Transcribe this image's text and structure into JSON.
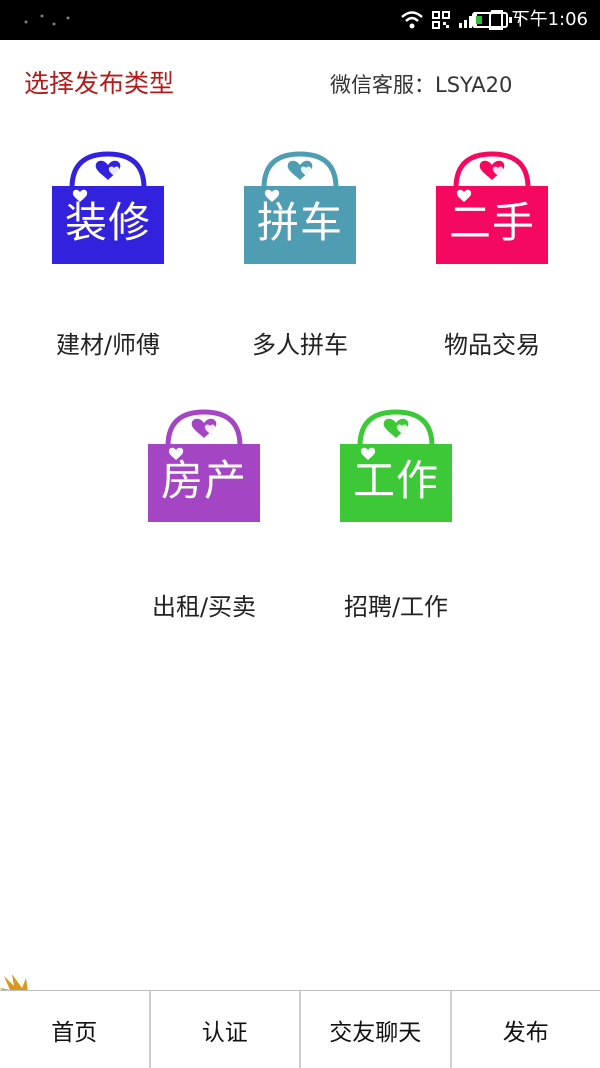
{
  "statusbar": {
    "time": "下午1:06"
  },
  "header": {
    "title": "选择发布类型",
    "service": "微信客服：LSYA20"
  },
  "categories": [
    {
      "icon_text": "装修",
      "label": "建材/师傅",
      "color": "#3322dd"
    },
    {
      "icon_text": "拼车",
      "label": "多人拼车",
      "color": "#4f9db2"
    },
    {
      "icon_text": "二手",
      "label": "物品交易",
      "color": "#f5085f"
    },
    {
      "icon_text": "房产",
      "label": "出租/买卖",
      "color": "#a445c4"
    },
    {
      "icon_text": "工作",
      "label": "招聘/工作",
      "color": "#3cc837"
    }
  ],
  "bottomnav": [
    {
      "label": "首页"
    },
    {
      "label": "认证"
    },
    {
      "label": "交友聊天"
    },
    {
      "label": "发布"
    }
  ]
}
